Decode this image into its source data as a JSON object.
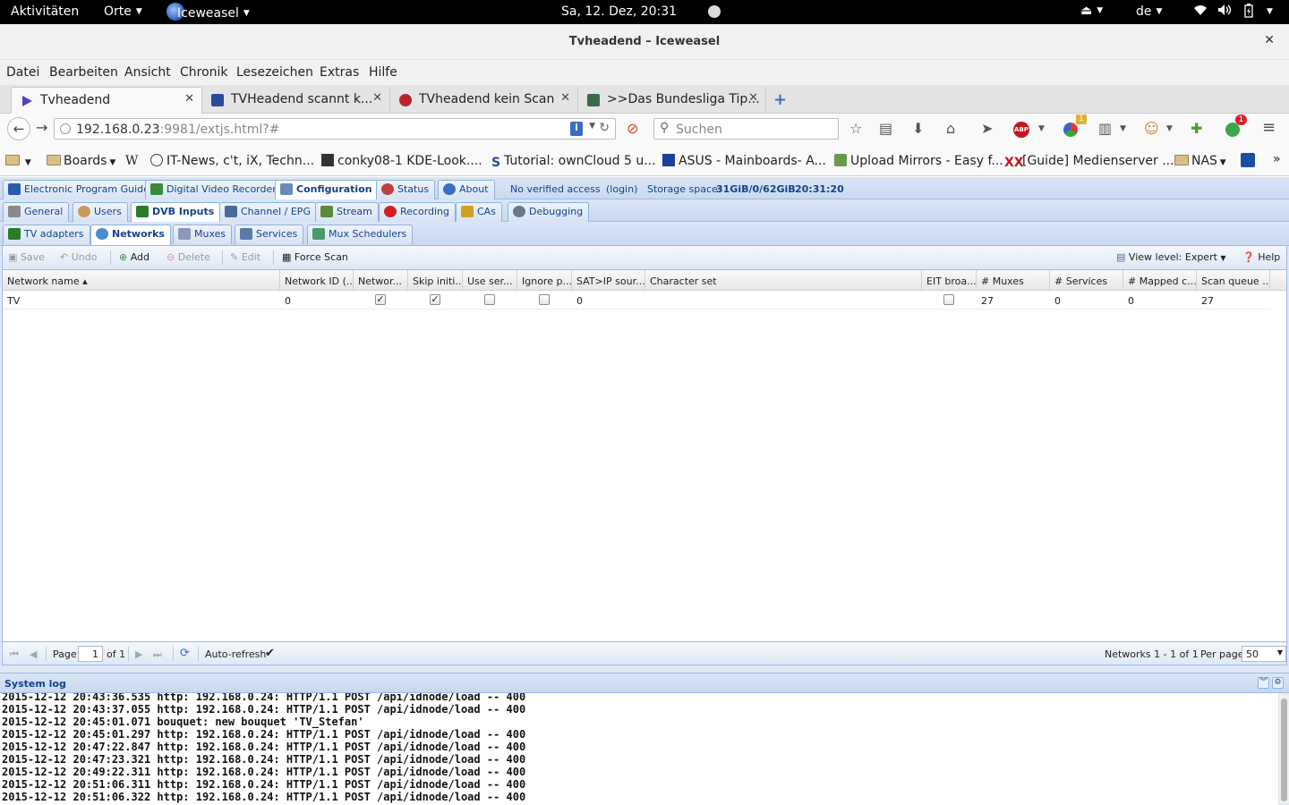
{
  "gnome": {
    "activities": "Aktivitäten",
    "places": "Orte",
    "app": "Iceweasel",
    "clock": "Sa, 12. Dez, 20:31",
    "lang": "de"
  },
  "window": {
    "title": "Tvheadend – Iceweasel"
  },
  "menu": [
    "Datei",
    "Bearbeiten",
    "Ansicht",
    "Chronik",
    "Lesezeichen",
    "Extras",
    "Hilfe"
  ],
  "browser_tabs": [
    {
      "label": "Tvheadend",
      "color": "#5b3fc4"
    },
    {
      "label": "TVHeadend scannt k...",
      "color": "#2a4a9a"
    },
    {
      "label": "TVheadend kein Scan",
      "color": "#b8222b"
    },
    {
      "label": ">>Das Bundesliga Tip...",
      "color": "#3b6a4a"
    }
  ],
  "nav": {
    "url_host": "192.168.0.23",
    "url_rest": ":9981/extjs.html?#",
    "search_placeholder": "Suchen",
    "abp_label": "ABP",
    "badge_one": "1",
    "badge_two": "1"
  },
  "bookmarks": [
    "",
    "Boards",
    "W",
    "IT-News, c't, iX, Techn...",
    "conky08-1 KDE-Look....",
    "Tutorial: ownCloud 5 u...",
    "ASUS - Mainboards- A...",
    "Upload Mirrors - Easy f...",
    "[Guide] Medienserver ...",
    "NAS"
  ],
  "tvh": {
    "main_tabs": [
      "Electronic Program Guide",
      "Digital Video Recorder",
      "Configuration",
      "Status",
      "About"
    ],
    "access": "No verified access",
    "login": "(login)",
    "storage_label": "Storage space:",
    "storage_value": "31GiB/0/62GiB",
    "time": "20:31:20",
    "config_tabs": [
      "General",
      "Users",
      "DVB Inputs",
      "Channel / EPG",
      "Stream",
      "Recording",
      "CAs",
      "Debugging"
    ],
    "dvb_tabs": [
      "TV adapters",
      "Networks",
      "Muxes",
      "Services",
      "Mux Schedulers"
    ],
    "toolbar": {
      "save": "Save",
      "undo": "Undo",
      "add": "Add",
      "delete": "Delete",
      "edit": "Edit",
      "force_scan": "Force Scan",
      "view_level": "View level: Expert",
      "help": "Help"
    },
    "columns": [
      "Network name ▴",
      "Network ID (...",
      "Networ...",
      "Skip initi...",
      "Use ser...",
      "Ignore p...",
      "SAT>IP sour...",
      "Character set",
      "EIT broa...",
      "# Muxes",
      "# Services",
      "# Mapped c...",
      "Scan queue ..."
    ],
    "rows": [
      {
        "name": "TV",
        "network_id": "0",
        "network_discovery": true,
        "skip_initial": true,
        "use_service_ids": false,
        "ignore_provider": false,
        "satip_source": "0",
        "charset": "",
        "eit_broadcast": false,
        "muxes": "27",
        "services": "0",
        "mapped": "0",
        "scan_queue": "27"
      }
    ],
    "pager": {
      "page_label": "Page",
      "page": "1",
      "of": "of 1",
      "auto_refresh": "Auto-refresh",
      "summary": "Networks 1 - 1 of 1",
      "per_page_label": "Per page",
      "per_page": "50"
    },
    "log_title": "System log",
    "log_lines": [
      "2015-12-12 20:43:36.535 http: 192.168.0.24: HTTP/1.1 POST /api/idnode/load -- 400",
      "2015-12-12 20:43:37.055 http: 192.168.0.24: HTTP/1.1 POST /api/idnode/load -- 400",
      "2015-12-12 20:45:01.071 bouquet: new bouquet 'TV_Stefan'",
      "2015-12-12 20:45:01.297 http: 192.168.0.24: HTTP/1.1 POST /api/idnode/load -- 400",
      "2015-12-12 20:47:22.847 http: 192.168.0.24: HTTP/1.1 POST /api/idnode/load -- 400",
      "2015-12-12 20:47:23.321 http: 192.168.0.24: HTTP/1.1 POST /api/idnode/load -- 400",
      "2015-12-12 20:49:22.311 http: 192.168.0.24: HTTP/1.1 POST /api/idnode/load -- 400",
      "2015-12-12 20:51:06.311 http: 192.168.0.24: HTTP/1.1 POST /api/idnode/load -- 400",
      "2015-12-12 20:51:06.322 http: 192.168.0.24: HTTP/1.1 POST /api/idnode/load -- 400"
    ]
  }
}
